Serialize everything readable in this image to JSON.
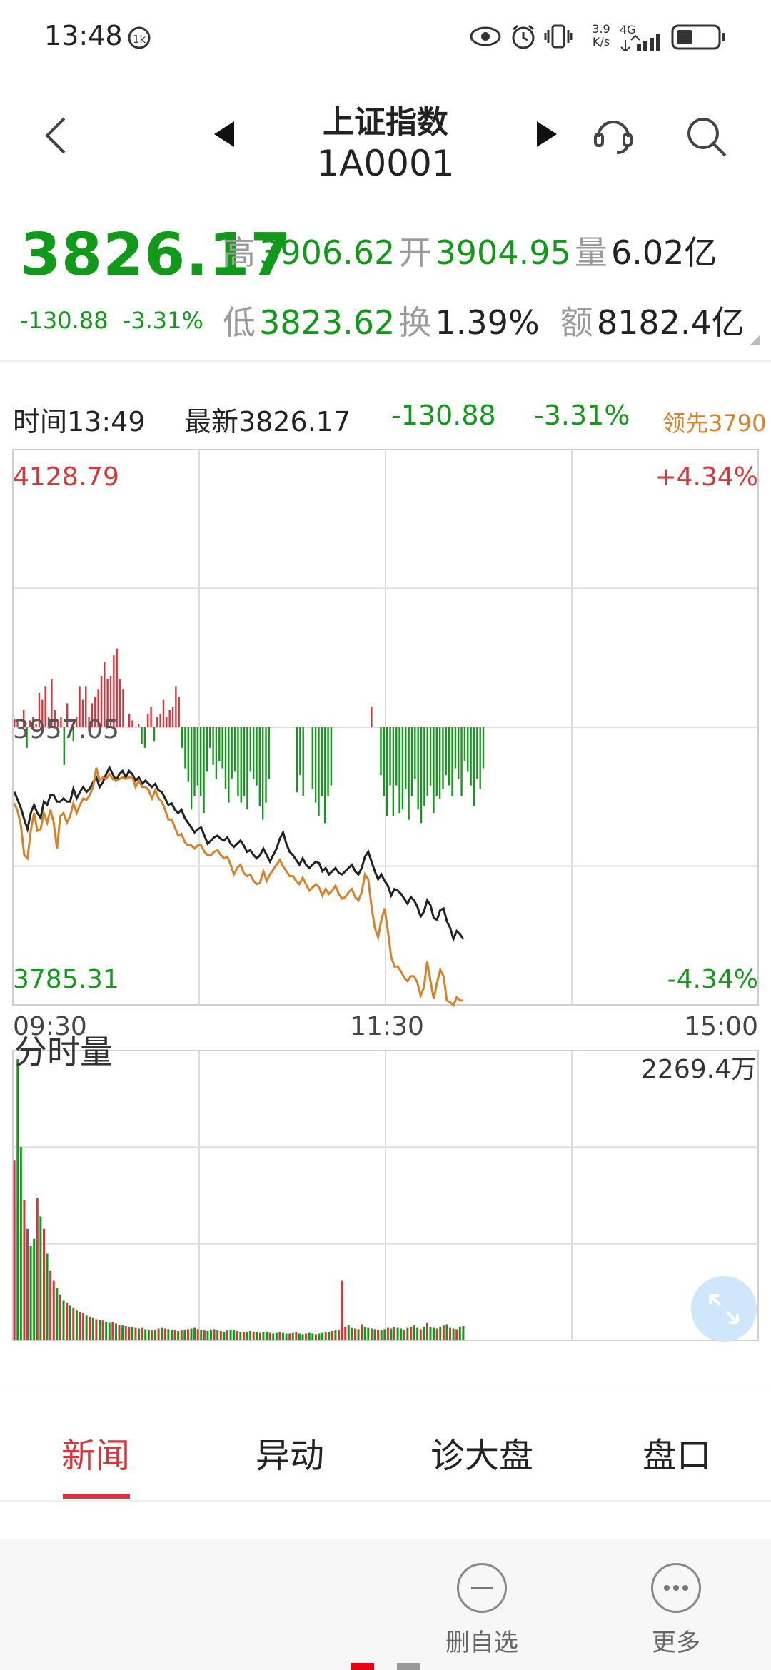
{
  "status_bar": {
    "time": "13:48",
    "network_speed": "3.9\nK/s",
    "network_speed_top": "3.9",
    "network_speed_bottom": "K/s",
    "network_type": "4G"
  },
  "header": {
    "name": "上证指数",
    "code": "1A0001"
  },
  "quote": {
    "price": "3826.17",
    "change": "-130.88",
    "change_pct": "-3.31%",
    "high_label": "高",
    "high": "3906.62",
    "open_label": "开",
    "open": "3904.95",
    "volume_label": "量",
    "volume": "6.02亿",
    "low_label": "低",
    "low": "3823.62",
    "turnover_label": "换",
    "turnover": "1.39%",
    "amount_label": "额",
    "amount": "8182.4亿"
  },
  "info_row": {
    "time_label": "时间13:49",
    "latest_label": "最新3826.17",
    "change": "-130.88",
    "change_pct": "-3.31%",
    "lead_label": "领先3790"
  },
  "colors": {
    "up": "#d9343a",
    "down": "#119a1a",
    "price_line": "#222222",
    "lead_line": "#d7822b",
    "grid": "#dddddd"
  },
  "chart_data": [
    {
      "type": "line",
      "title": "",
      "ylim": [
        3785.31,
        4128.79
      ],
      "y_top_label": "4128.79",
      "y_mid_label": "3957.05",
      "y_bottom_label": "3785.31",
      "pct_top_label": "+4.34%",
      "pct_bottom_label": "-4.34%",
      "x_tick_labels": [
        "09:30",
        "11:30",
        "15:00"
      ],
      "series": [
        {
          "key": "price",
          "values": [
            3917,
            3912,
            3907,
            3900,
            3894,
            3904,
            3909,
            3904,
            3901,
            3911,
            3909,
            3915,
            3915,
            3911,
            3911,
            3913,
            3911,
            3911,
            3919,
            3913,
            3917,
            3920,
            3917,
            3919,
            3923,
            3926,
            3920,
            3923,
            3928,
            3932,
            3928,
            3924,
            3928,
            3930,
            3926,
            3930,
            3928,
            3924,
            3926,
            3922,
            3924,
            3922,
            3920,
            3922,
            3918,
            3917,
            3913,
            3909,
            3910,
            3906,
            3904,
            3906,
            3901,
            3898,
            3895,
            3892,
            3894,
            3895,
            3890,
            3885,
            3887,
            3889,
            3890,
            3888,
            3887,
            3889,
            3885,
            3883,
            3885,
            3887,
            3884,
            3880,
            3881,
            3878,
            3876,
            3878,
            3882,
            3878,
            3874,
            3878,
            3882,
            3888,
            3892,
            3885,
            3880,
            3878,
            3875,
            3872,
            3876,
            3872,
            3870,
            3872,
            3874,
            3873,
            3868,
            3870,
            3866,
            3868,
            3870,
            3867,
            3866,
            3868,
            3870,
            3872,
            3868,
            3866,
            3870,
            3877,
            3880,
            3874,
            3868,
            3863,
            3866,
            3862,
            3859,
            3853,
            3857,
            3856,
            3854,
            3851,
            3848,
            3852,
            3850,
            3846,
            3840,
            3843,
            3850,
            3847,
            3839,
            3838,
            3844,
            3845,
            3837,
            3833,
            3826,
            3831,
            3829,
            3826
          ]
        },
        {
          "key": "lead",
          "values": [
            3910,
            3905,
            3896,
            3878,
            3876,
            3893,
            3904,
            3893,
            3894,
            3904,
            3898,
            3906,
            3898,
            3882,
            3902,
            3904,
            3898,
            3902,
            3910,
            3904,
            3909,
            3913,
            3912,
            3915,
            3920,
            3932,
            3924,
            3926,
            3925,
            3928,
            3925,
            3924,
            3925,
            3926,
            3925,
            3926,
            3926,
            3920,
            3924,
            3920,
            3920,
            3918,
            3913,
            3918,
            3913,
            3911,
            3906,
            3900,
            3900,
            3895,
            3890,
            3891,
            3886,
            3884,
            3884,
            3882,
            3884,
            3884,
            3880,
            3878,
            3878,
            3880,
            3881,
            3878,
            3876,
            3877,
            3872,
            3866,
            3870,
            3872,
            3867,
            3865,
            3866,
            3862,
            3860,
            3861,
            3868,
            3862,
            3866,
            3869,
            3872,
            3875,
            3871,
            3868,
            3865,
            3865,
            3862,
            3860,
            3864,
            3860,
            3856,
            3858,
            3860,
            3858,
            3853,
            3857,
            3854,
            3856,
            3859,
            3854,
            3851,
            3852,
            3855,
            3857,
            3852,
            3850,
            3855,
            3866,
            3863,
            3846,
            3833,
            3827,
            3838,
            3845,
            3831,
            3815,
            3809,
            3809,
            3806,
            3802,
            3800,
            3803,
            3803,
            3799,
            3791,
            3796,
            3812,
            3800,
            3789,
            3799,
            3807,
            3803,
            3788,
            3787,
            3785,
            3790,
            3788,
            3788
          ]
        }
      ]
    },
    {
      "type": "bar",
      "title": "",
      "note": "lead/lag bars above/below mid line (relative magnitude 0-100)",
      "values": [
        5,
        3,
        0,
        10,
        -12,
        4,
        6,
        2,
        20,
        16,
        24,
        6,
        28,
        10,
        4,
        6,
        -22,
        14,
        0,
        -8,
        6,
        24,
        16,
        24,
        6,
        14,
        18,
        22,
        30,
        38,
        28,
        30,
        42,
        46,
        28,
        22,
        0,
        8,
        4,
        0,
        2,
        -10,
        -12,
        8,
        12,
        -8,
        6,
        8,
        16,
        6,
        10,
        12,
        24,
        18,
        -12,
        -24,
        -32,
        -48,
        -40,
        -34,
        -40,
        -50,
        -26,
        -12,
        -22,
        -30,
        -20,
        -24,
        -36,
        -44,
        -30,
        -26,
        -40,
        -44,
        -40,
        -48,
        -26,
        -30,
        -34,
        -46,
        -54,
        -44,
        -30,
        0,
        0,
        0,
        0,
        0,
        0,
        0,
        0,
        -38,
        -28,
        -40,
        0,
        0,
        -36,
        -44,
        -52,
        -40,
        -56,
        -40,
        -34,
        0,
        0,
        0,
        0,
        0,
        0,
        0,
        0,
        0,
        0,
        0,
        0,
        12,
        0,
        0,
        -28,
        -40,
        -52,
        -34,
        -52,
        -34,
        -50,
        -48,
        -36,
        -54,
        -40,
        -30,
        -48,
        -56,
        -46,
        -40,
        -34,
        -50,
        -40,
        -42,
        -36,
        -28,
        -34,
        -40,
        -24,
        -30,
        -40,
        -20,
        -26,
        -34,
        -46,
        -30,
        -36,
        -24,
        0
      ]
    },
    {
      "type": "bar",
      "title": "分时量",
      "max_label": "2269.4万",
      "ylim": [
        0,
        2269.4
      ],
      "values": [
        1450,
        2269,
        1560,
        1130,
        900,
        760,
        820,
        1150,
        1000,
        900,
        700,
        560,
        480,
        420,
        370,
        320,
        300,
        280,
        260,
        240,
        230,
        220,
        200,
        190,
        180,
        170,
        165,
        160,
        150,
        140,
        150,
        135,
        125,
        120,
        115,
        110,
        105,
        100,
        95,
        100,
        90,
        85,
        80,
        85,
        95,
        100,
        95,
        90,
        85,
        80,
        75,
        80,
        85,
        90,
        95,
        100,
        90,
        85,
        80,
        75,
        85,
        90,
        80,
        75,
        70,
        80,
        85,
        80,
        75,
        70,
        65,
        70,
        75,
        70,
        65,
        60,
        65,
        70,
        60,
        55,
        60,
        65,
        60,
        55,
        55,
        60,
        65,
        55,
        50,
        55,
        60,
        55,
        50,
        55,
        60,
        65,
        70,
        75,
        80,
        85,
        480,
        110,
        120,
        100,
        95,
        90,
        130,
        110,
        100,
        95,
        90,
        85,
        80,
        90,
        100,
        95,
        110,
        100,
        95,
        85,
        100,
        110,
        120,
        100,
        90,
        110,
        140,
        110,
        100,
        95,
        110,
        120,
        130,
        100,
        95,
        90,
        110,
        115
      ],
      "colors": [
        "up",
        "down",
        "down",
        "up",
        "up",
        "down",
        "down",
        "up",
        "down",
        "up",
        "down",
        "up",
        "up",
        "down",
        "up",
        "down",
        "up",
        "down",
        "up",
        "down",
        "up",
        "up",
        "down",
        "up",
        "down",
        "up",
        "down",
        "up",
        "down",
        "down",
        "up",
        "down",
        "up",
        "down",
        "up",
        "up",
        "down",
        "up",
        "down",
        "up",
        "down",
        "down",
        "up",
        "down",
        "up",
        "down",
        "up",
        "down",
        "down",
        "up",
        "down",
        "up",
        "down",
        "up",
        "down",
        "down",
        "up",
        "down",
        "up",
        "down",
        "down",
        "up",
        "down",
        "up",
        "down",
        "up",
        "down",
        "down",
        "up",
        "down",
        "up",
        "down",
        "down",
        "up",
        "down",
        "up",
        "down",
        "down",
        "up",
        "down",
        "down",
        "up",
        "down",
        "down",
        "up",
        "down",
        "up",
        "down",
        "down",
        "up",
        "down",
        "down",
        "up",
        "down",
        "down",
        "up",
        "down",
        "up",
        "down",
        "up",
        "up",
        "up",
        "down",
        "down",
        "up",
        "down",
        "up",
        "down",
        "down",
        "up",
        "down",
        "up",
        "down",
        "down",
        "up",
        "down",
        "up",
        "down",
        "down",
        "up",
        "down",
        "up",
        "down",
        "down",
        "up",
        "down",
        "up",
        "down",
        "down",
        "up",
        "down",
        "up",
        "down",
        "up",
        "down",
        "up",
        "down",
        "down",
        "up"
      ]
    }
  ],
  "tabs": [
    {
      "label": "新闻",
      "active": true
    },
    {
      "label": "异动",
      "active": false
    },
    {
      "label": "诊大盘",
      "active": false
    },
    {
      "label": "盘口",
      "active": false
    }
  ],
  "bottom_bar": {
    "remove_label": "删自选",
    "more_label": "更多"
  }
}
